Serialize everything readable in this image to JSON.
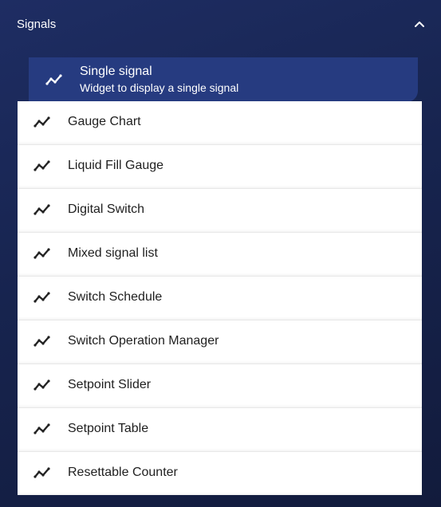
{
  "header": {
    "title": "Signals",
    "expanded": true,
    "toggle_icon": "chevron-up-icon"
  },
  "selected": {
    "title": "Single signal",
    "description": "Widget to display a single signal",
    "icon": "signal-line-icon"
  },
  "items": [
    {
      "label": "Gauge Chart",
      "icon": "signal-line-icon"
    },
    {
      "label": "Liquid Fill Gauge",
      "icon": "signal-line-icon"
    },
    {
      "label": "Digital Switch",
      "icon": "signal-line-icon"
    },
    {
      "label": "Mixed signal list",
      "icon": "signal-line-icon"
    },
    {
      "label": "Switch Schedule",
      "icon": "signal-line-icon"
    },
    {
      "label": "Switch Operation Manager",
      "icon": "signal-line-icon"
    },
    {
      "label": "Setpoint Slider",
      "icon": "signal-line-icon"
    },
    {
      "label": "Setpoint Table",
      "icon": "signal-line-icon"
    },
    {
      "label": "Resettable Counter",
      "icon": "signal-line-icon"
    }
  ],
  "colors": {
    "background": "#1b2857",
    "selected_background": "#263b80",
    "item_background": "#ffffff",
    "item_text": "#1f1f1f",
    "header_text": "#ffffff"
  }
}
